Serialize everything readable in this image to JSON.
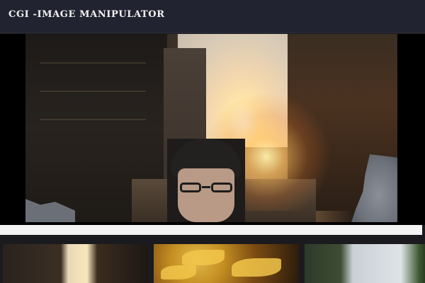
{
  "app": {
    "title": "CGI -IMAGE MANIPULATOR"
  },
  "main_image": {
    "alt": "Composited image: portrait of a man wearing glasses over a sunlit city street"
  },
  "progress": {
    "fraction": 1.0
  },
  "thumbnails": [
    {
      "alt": "Sunlit city street thumbnail"
    },
    {
      "alt": "Autumn leaves thumbnail"
    },
    {
      "alt": "Trees and sky thumbnail"
    }
  ],
  "colors": {
    "header_bg": "#222330",
    "title_text": "#f2f2f2",
    "page_bg": "#1b1b1f",
    "progress_track": "#e9e9e9"
  }
}
